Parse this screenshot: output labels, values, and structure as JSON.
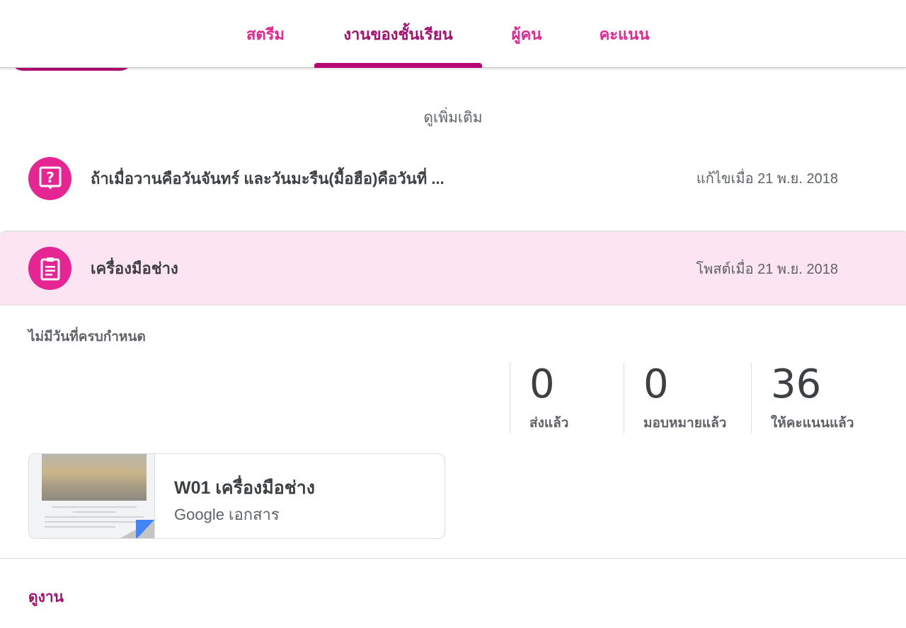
{
  "nav": {
    "tabs": [
      {
        "label": "สตรีม"
      },
      {
        "label": "งานของชั้นเรียน"
      },
      {
        "label": "ผู้คน"
      },
      {
        "label": "คะแนน"
      }
    ],
    "active_tab": "งานของชั้นเรียน"
  },
  "see_more": "ดูเพิ่มเติม",
  "question_item": {
    "icon": "question-icon",
    "title": "ถ้าเมื่อวานคือวันจันทร์ และวันมะรืน(มื้อฮือ)คือวันที่ ...",
    "date": "แก้ไขเมื่อ 21 พ.ย. 2018"
  },
  "assignment": {
    "icon": "assignment-icon",
    "title": "เครื่องมือช่าง",
    "date": "โพสต์เมื่อ 21 พ.ย. 2018",
    "due": "ไม่มีวันที่ครบกำหนด",
    "stats": [
      {
        "value": "0",
        "label": "ส่งแล้ว"
      },
      {
        "value": "0",
        "label": "มอบหมายแล้ว"
      },
      {
        "value": "36",
        "label": "ให้คะแนนแล้ว"
      }
    ],
    "attachment": {
      "title": "W01 เครื่องมือช่าง",
      "type": "Google เอกสาร"
    },
    "view_work": "ดูงาน"
  },
  "colors": {
    "accent": "#e52592",
    "accent_dark": "#a50e6e",
    "header_bg": "#fce4f2",
    "docs_blue": "#4285f4"
  }
}
